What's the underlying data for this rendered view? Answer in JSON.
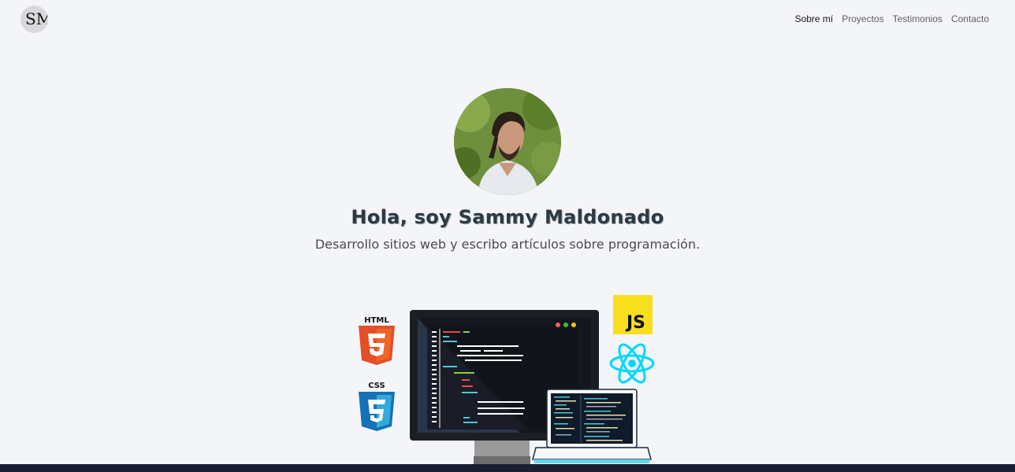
{
  "brand": {
    "logo_text": "SM"
  },
  "nav": {
    "items": [
      {
        "label": "Sobre mí",
        "active": true
      },
      {
        "label": "Proyectos",
        "active": false
      },
      {
        "label": "Testimonios",
        "active": false
      },
      {
        "label": "Contacto",
        "active": false
      }
    ]
  },
  "hero": {
    "title": "Hola, soy Sammy Maldonado",
    "subtitle": "Desarrollo sitios web y escribo artículos sobre programación.",
    "badges": {
      "html": "HTML",
      "css": "CSS",
      "js": "JS"
    }
  },
  "colors": {
    "background": "#f4f5f8",
    "footer": "#1b1d33",
    "html_orange": "#e34f26",
    "css_blue": "#2965f1",
    "js_yellow": "#f7df1e",
    "react_cyan": "#00d8ff"
  }
}
